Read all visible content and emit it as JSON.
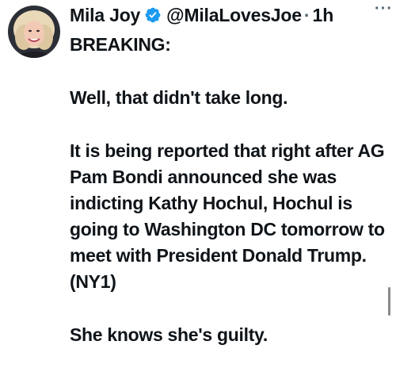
{
  "author": {
    "display_name": "Mila Joy",
    "handle": "@MilaLovesJoe",
    "separator": "·",
    "time": "1h",
    "verified_icon": "verified-badge-icon",
    "verified_color": "#1d9bf0"
  },
  "more_menu": {
    "label": "···",
    "icon": "more-icon"
  },
  "tweet": {
    "paragraphs": [
      "BREAKING:",
      "Well, that didn't take long.",
      "It is being reported that right after AG Pam Bondi announced she was indicting Kathy Hochul, Hochul is going to Washington DC tomorrow to meet with President Donald Trump. (NY1)",
      "She knows she's guilty."
    ]
  }
}
